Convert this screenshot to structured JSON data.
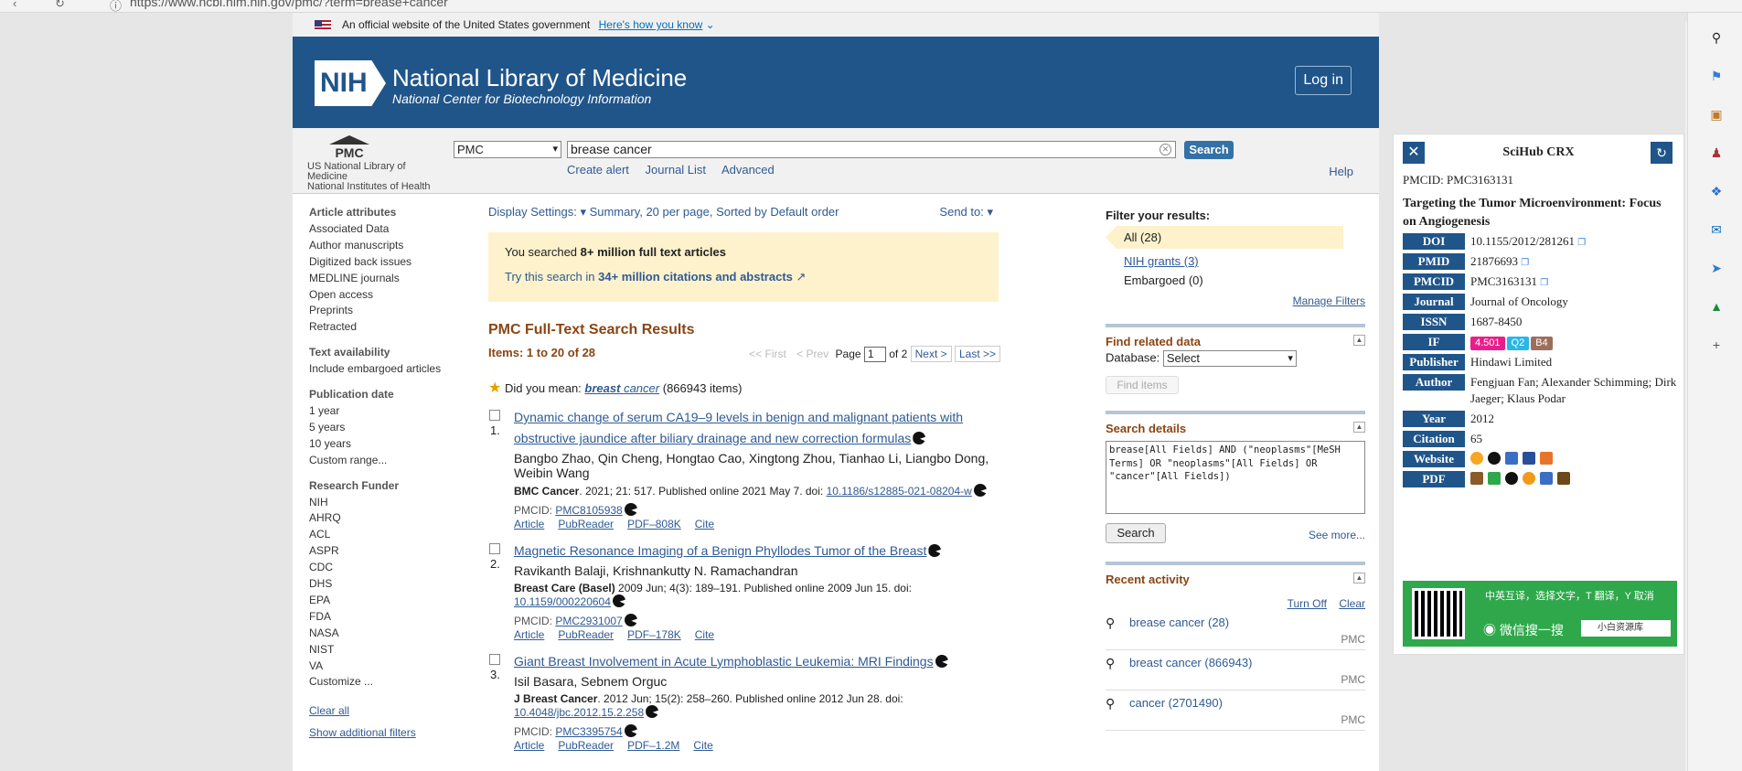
{
  "browser": {
    "url": "https://www.ncbi.nlm.nih.gov/pmc/?term=brease+cancer"
  },
  "gov_banner": {
    "text": "An official website of the United States government",
    "link": "Here's how you know"
  },
  "masthead": {
    "logo": "NIH",
    "title": "National Library of Medicine",
    "subtitle": "National Center for Biotechnology Information",
    "login": "Log in"
  },
  "searchbar": {
    "pmc_logo": "PMC",
    "org_line1": "US National Library of",
    "org_line2": "Medicine",
    "org_line3": "National Institutes of Health",
    "db_value": "PMC",
    "term": "brease cancer",
    "search_btn": "Search",
    "create_alert": "Create alert",
    "journal_list": "Journal List",
    "advanced": "Advanced",
    "help": "Help"
  },
  "filters": {
    "article_attributes_title": "Article attributes",
    "article_attributes": [
      "Associated Data",
      "Author manuscripts",
      "Digitized back issues",
      "MEDLINE journals",
      "Open access",
      "Preprints",
      "Retracted"
    ],
    "text_availability_title": "Text availability",
    "text_availability": [
      "Include embargoed articles"
    ],
    "publication_date_title": "Publication date",
    "publication_date": [
      "1 year",
      "5 years",
      "10 years",
      "Custom range..."
    ],
    "research_funder_title": "Research Funder",
    "research_funder": [
      "NIH",
      "AHRQ",
      "ACL",
      "ASPR",
      "CDC",
      "DHS",
      "EPA",
      "FDA",
      "NASA",
      "NIST",
      "VA",
      "Customize ..."
    ],
    "clear_all": "Clear all",
    "show_additional": "Show additional filters"
  },
  "center": {
    "display_settings_label": "Display Settings:",
    "display_settings_value": "Summary, 20 per page, Sorted by Default order",
    "send_to": "Send to:",
    "searched_prefix": "You searched",
    "searched_bold": "8+ million full text articles",
    "try_prefix": "Try this search in",
    "try_bold": "34+ million citations and abstracts",
    "results_title": "PMC Full-Text Search Results",
    "items": "Items: 1 to 20 of 28",
    "pager": {
      "first": "<< First",
      "prev": "< Prev",
      "page_label": "Page",
      "page_value": "1",
      "of": "of 2",
      "next": "Next >",
      "last": "Last >>"
    },
    "did_you_mean_label": "Did you mean:",
    "did_you_mean_bold": "breast",
    "did_you_mean_rest": "cancer",
    "did_you_mean_count": "(866943 items)"
  },
  "results": [
    {
      "num": "1.",
      "title": "Dynamic change of serum CA19–9 levels in benign and malignant patients with obstructive jaundice after biliary drainage and new correction formulas",
      "authors": "Bangbo Zhao, Qin Cheng, Hongtao Cao, Xingtong Zhou, Tianhao Li, Liangbo Dong, Weibin Wang",
      "journal": "BMC Cancer",
      "cite": ". 2021; 21: 517. Published online 2021 May 7. doi: ",
      "doi": "10.1186/s12885-021-08204-w",
      "pmcid_label": "PMCID:",
      "pmcid": "PMC8105938",
      "links": [
        "Article",
        "PubReader",
        "PDF–808K",
        "Cite"
      ]
    },
    {
      "num": "2.",
      "title": "Magnetic Resonance Imaging of a Benign Phyllodes Tumor of the Breast",
      "authors": "Ravikanth Balaji, Krishnankutty N. Ramachandran",
      "journal": "Breast Care (Basel)",
      "cite": " 2009 Jun; 4(3): 189–191. Published online 2009 Jun 15. doi: ",
      "doi": "10.1159/000220604",
      "pmcid_label": "PMCID:",
      "pmcid": "PMC2931007",
      "links": [
        "Article",
        "PubReader",
        "PDF–178K",
        "Cite"
      ]
    },
    {
      "num": "3.",
      "title": "Giant Breast Involvement in Acute Lymphoblastic Leukemia: MRI Findings",
      "authors": "Isil Basara, Sebnem Orguc",
      "journal": "J Breast Cancer",
      "cite": ". 2012 Jun; 15(2): 258–260. Published online 2012 Jun 28. doi: ",
      "doi": "10.4048/jbc.2012.15.2.258",
      "pmcid_label": "PMCID:",
      "pmcid": "PMC3395754",
      "links": [
        "Article",
        "PubReader",
        "PDF–1.2M",
        "Cite"
      ]
    }
  ],
  "right": {
    "filter_title": "Filter your results:",
    "all": "All (28)",
    "nih_grants": "NIH grants (3)",
    "embargoed": "Embargoed (0)",
    "manage_filters": "Manage Filters",
    "find_related_title": "Find related data",
    "database_label": "Database:",
    "database_value": "Select",
    "find_items": "Find items",
    "search_details_title": "Search details",
    "search_details_text": "brease[All Fields] AND (\"neoplasms\"[MeSH Terms] OR \"neoplasms\"[All Fields] OR \"cancer\"[All Fields])",
    "search_btn": "Search",
    "see_more": "See more...",
    "recent_title": "Recent activity",
    "turn_off": "Turn Off",
    "clear": "Clear",
    "recent": [
      {
        "text": "brease cancer (28)",
        "db": "PMC"
      },
      {
        "text": "breast cancer (866943)",
        "db": "PMC"
      },
      {
        "text": "cancer (2701490)",
        "db": "PMC"
      }
    ]
  },
  "scihub": {
    "title": "SciHub CRX",
    "pmcid_line": "PMCID: PMC3163131",
    "article_title": "Targeting the Tumor Microenvironment: Focus on Angiogenesis",
    "rows": {
      "doi_label": "DOI",
      "doi": "10.1155/2012/281261",
      "pmid_label": "PMID",
      "pmid": "21876693",
      "pmcid_label": "PMCID",
      "pmcid": "PMC3163131",
      "journal_label": "Journal",
      "journal": "Journal of Oncology",
      "issn_label": "ISSN",
      "issn": "1687-8450",
      "if_label": "IF",
      "if_value": "4.501",
      "q": "Q2",
      "b": "B4",
      "publisher_label": "Publisher",
      "publisher": "Hindawi Limited",
      "author_label": "Author",
      "author": "Fengjuan Fan; Alexander Schimming; Dirk Jaeger; Klaus Podar",
      "year_label": "Year",
      "year": "2012",
      "citation_label": "Citation",
      "citation": "65",
      "website_label": "Website",
      "pdf_label": "PDF"
    },
    "ad": {
      "top": "中英互译，选择文字，T 翻译，Y 取消",
      "wechat": "微信搜一搜",
      "search_box": "小白资源库"
    }
  }
}
